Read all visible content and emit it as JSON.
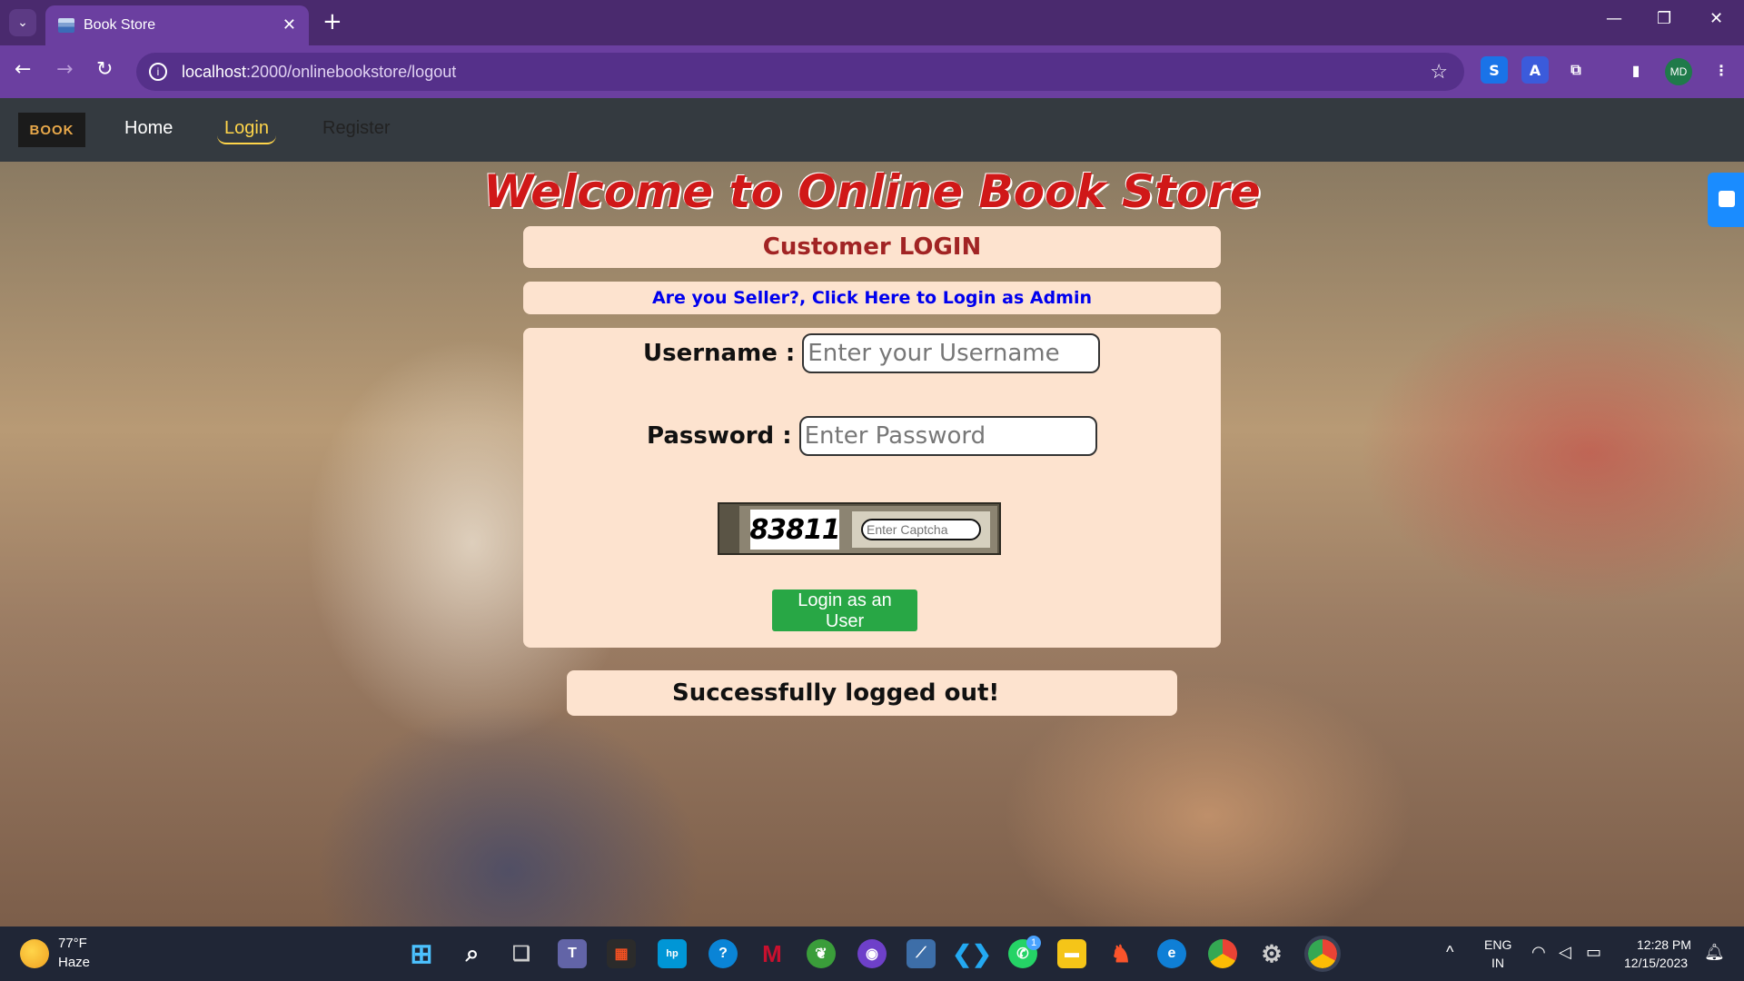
{
  "browser": {
    "tab_title": "Book Store",
    "url_host": "localhost",
    "url_path": ":2000/onlinebookstore/logout",
    "profile_initials": "MD"
  },
  "navbar": {
    "brand": "BOOK",
    "links": [
      "Home",
      "Login",
      "Register"
    ],
    "active": "Login"
  },
  "page": {
    "welcome": "Welcome to Online Book Store",
    "login_title": "Customer LOGIN",
    "admin_link": "Are you Seller?, Click Here to Login as Admin",
    "username_label": "Username :",
    "username_placeholder": "Enter your Username",
    "password_label": "Password :",
    "password_placeholder": "Enter Password",
    "captcha_code": "83811",
    "captcha_placeholder": "Enter Captcha",
    "login_button": "Login as an User",
    "message": "Successfully logged out!"
  },
  "taskbar": {
    "weather_temp": "77°F",
    "weather_condition": "Haze",
    "language": "ENG",
    "region": "IN",
    "time": "12:28 PM",
    "date": "12/15/2023",
    "whatsapp_badge": "1",
    "icons": [
      "windows-start-icon",
      "search-icon",
      "task-view-icon",
      "teams-icon",
      "microsoft-store-icon",
      "myhp-icon",
      "hp-support-icon",
      "mcafee-icon",
      "chat-app-icon",
      "github-icon",
      "jetbrains-icon",
      "vscode-icon",
      "whatsapp-icon",
      "file-explorer-icon",
      "brave-icon",
      "edge-icon",
      "chrome-icon",
      "settings-icon",
      "chrome-profile-icon"
    ]
  },
  "colors": {
    "accent_purple": "#6b3fa0",
    "navbar": "#343a40",
    "card": "#fde3cf",
    "login_button": "#28a745",
    "welcome_text": "#d01818",
    "admin_link": "#0000ee"
  }
}
